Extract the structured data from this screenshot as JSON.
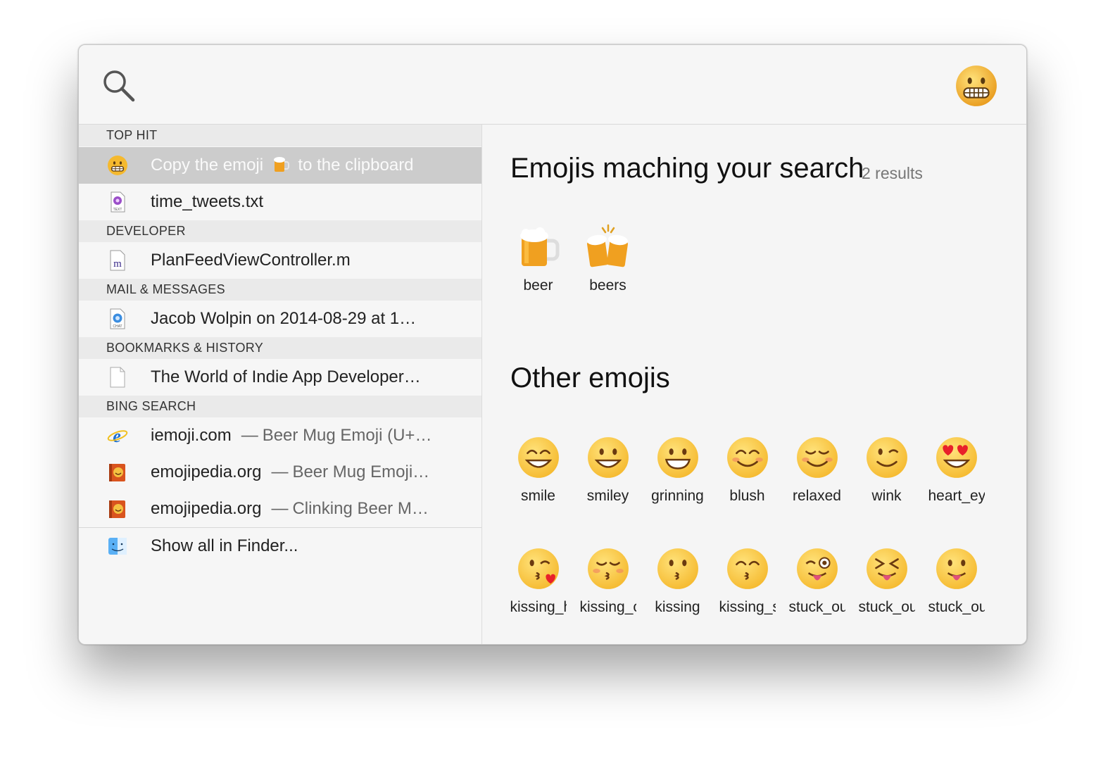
{
  "search": {
    "query": "",
    "placeholder": ""
  },
  "top_emoji": "grimacing",
  "sections": [
    {
      "header": "TOP HIT",
      "rows": [
        {
          "icon": "grimacing-emoji-icon",
          "text_a": "Copy the emoji",
          "text_b": "to the clipboard",
          "selected": true
        },
        {
          "icon": "text-file-icon",
          "text": "time_tweets.txt"
        }
      ]
    },
    {
      "header": "DEVELOPER",
      "rows": [
        {
          "icon": "objc-file-icon",
          "text": "PlanFeedViewController.m"
        }
      ]
    },
    {
      "header": "MAIL & MESSAGES",
      "rows": [
        {
          "icon": "chat-file-icon",
          "text": "Jacob Wolpin on 2014-08-29 at 1…"
        }
      ]
    },
    {
      "header": "BOOKMARKS & HISTORY",
      "rows": [
        {
          "icon": "document-icon",
          "text": "The World of Indie App Developer…"
        }
      ]
    },
    {
      "header": "BING SEARCH",
      "rows": [
        {
          "icon": "internet-explorer-icon",
          "site": "iemoji.com",
          "desc": "Beer Mug Emoji (U+…"
        },
        {
          "icon": "emojipedia-icon",
          "site": "emojipedia.org",
          "desc": "Beer Mug Emoji…"
        },
        {
          "icon": "emojipedia-icon",
          "site": "emojipedia.org",
          "desc": "Clinking Beer M…"
        }
      ]
    }
  ],
  "show_all": {
    "icon": "finder-icon",
    "text": "Show all in Finder..."
  },
  "matching": {
    "title": "Emojis maching your search",
    "count": "2 results",
    "items": [
      {
        "emoji": "beer",
        "name": "beer"
      },
      {
        "emoji": "beers",
        "name": "beers"
      }
    ]
  },
  "other": {
    "title": "Other emojis",
    "items": [
      {
        "emoji": "smile",
        "name": "smile"
      },
      {
        "emoji": "smiley",
        "name": "smiley"
      },
      {
        "emoji": "grinning",
        "name": "grinning"
      },
      {
        "emoji": "blush",
        "name": "blush"
      },
      {
        "emoji": "relaxed",
        "name": "relaxed"
      },
      {
        "emoji": "wink",
        "name": "wink"
      },
      {
        "emoji": "heart_eyes",
        "name": "heart_eyes"
      },
      {
        "emoji": "kissing_heart",
        "name": "kissing_heart"
      },
      {
        "emoji": "kissing_closed_eyes",
        "name": "kissing_closed_eyes"
      },
      {
        "emoji": "kissing",
        "name": "kissing"
      },
      {
        "emoji": "kissing_smiling_eyes",
        "name": "kissing_smiling_eyes"
      },
      {
        "emoji": "stuck_out_tongue_winking_eye",
        "name": "stuck_out_tongue_winking_eye"
      },
      {
        "emoji": "stuck_out_tongue_closed_eyes",
        "name": "stuck_out_tongue_closed_eyes"
      },
      {
        "emoji": "stuck_out_tongue",
        "name": "stuck_out_tongue"
      }
    ]
  },
  "colors": {
    "selection": "#cccccc",
    "header_bg": "#eaeaea",
    "face": "#f5b92e"
  }
}
